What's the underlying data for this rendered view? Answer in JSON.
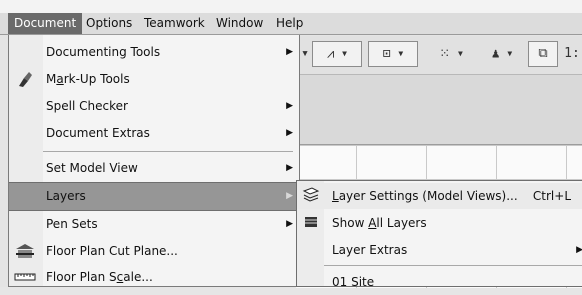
{
  "menubar": {
    "items": [
      {
        "label": "Document",
        "active": true
      },
      {
        "label": "Options"
      },
      {
        "label": "Teamwork"
      },
      {
        "label": "Window"
      },
      {
        "label": "Help"
      }
    ]
  },
  "toolbar": {
    "buttons": [
      {
        "icon": "tool-dropdown-icon",
        "symbol": "▾"
      },
      {
        "icon": "pen-tool-icon",
        "symbol": "⩘"
      },
      {
        "icon": "dimension-tool-icon",
        "symbol": "⊡"
      },
      {
        "icon": "snap-grid-icon",
        "symbol": "⁙"
      },
      {
        "icon": "pin-tool-icon",
        "symbol": "♟"
      },
      {
        "icon": "trace-reference-icon",
        "symbol": "⧉"
      },
      {
        "icon": "scale-ruler-icon",
        "symbol": "1:"
      }
    ]
  },
  "document_menu": {
    "items": [
      {
        "label": "Documenting Tools",
        "submenu": true
      },
      {
        "label": "Mark-Up Tools",
        "icon": "markup-pen-icon",
        "mnemonic": "a"
      },
      {
        "label": "Spell Checker",
        "submenu": true
      },
      {
        "label": "Document Extras",
        "submenu": true
      },
      {
        "label": "Set Model View",
        "submenu": true
      },
      {
        "label": "Layers",
        "submenu": true,
        "highlighted": true
      },
      {
        "label": "Pen Sets",
        "submenu": true
      },
      {
        "label": "Floor Plan Cut Plane...",
        "icon": "cut-plane-icon"
      },
      {
        "label": "Floor Plan Scale...",
        "icon": "floor-plan-scale-icon",
        "mnemonic": "c"
      }
    ]
  },
  "layers_submenu": {
    "items": [
      {
        "label": "Layer Settings (Model Views)...",
        "shortcut": "Ctrl+L",
        "icon": "layer-settings-icon",
        "mnemonic": "L",
        "highlighted": true
      },
      {
        "label": "Show All Layers",
        "icon": "show-layers-icon",
        "mnemonic": "A"
      },
      {
        "label": "Layer Extras",
        "submenu": true
      },
      {
        "label": "01 Site"
      }
    ]
  }
}
